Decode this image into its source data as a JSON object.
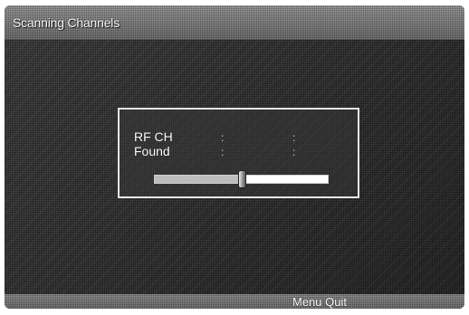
{
  "header": {
    "title": "Scanning Channels"
  },
  "scan_dialog": {
    "rf_channel_label": "RF CH",
    "found_label": "Found",
    "separator": ":",
    "progress": 0.5
  },
  "footer": {
    "menu_quit_label": "Menu Quit"
  }
}
